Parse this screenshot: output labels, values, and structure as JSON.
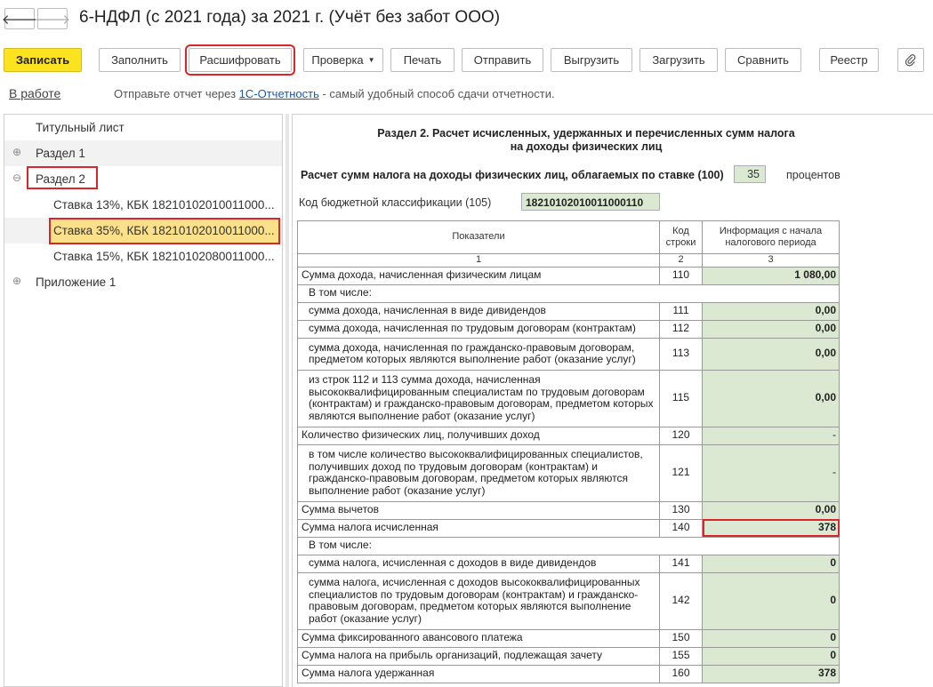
{
  "window": {
    "title": "6-НДФЛ (с 2021 года) за 2021 г. (Учёт без забот ООО)"
  },
  "nav": {
    "back": "🡐",
    "forward": "🡒"
  },
  "toolbar": {
    "save": "Записать",
    "fill": "Заполнить",
    "decode": "Расшифровать",
    "check": "Проверка",
    "print": "Печать",
    "send": "Отправить",
    "export": "Выгрузить",
    "import": "Загрузить",
    "compare": "Сравнить",
    "registry": "Реестр"
  },
  "status": {
    "state": "В работе",
    "hint_prefix": "Отправьте отчет через ",
    "hint_link": "1С-Отчетность",
    "hint_suffix": " - самый удобный способ сдачи отчетности."
  },
  "tree": {
    "items": [
      {
        "label": "Титульный лист"
      },
      {
        "label": "Раздел 1",
        "expander": "⊕"
      },
      {
        "label": "Раздел 2",
        "expander": "⊖"
      },
      {
        "label": "Ставка 13%, КБК 18210102010011000..."
      },
      {
        "label": "Ставка 35%, КБК 18210102010011000..."
      },
      {
        "label": "Ставка 15%, КБК 18210102080011000..."
      },
      {
        "label": "Приложение 1",
        "expander": "⊕"
      }
    ]
  },
  "form": {
    "section_title_1": "Раздел 2. Расчет исчисленных, удержанных и перечисленных сумм налога",
    "section_title_2": "на доходы физических лиц",
    "rate_label": "Расчет сумм налога на доходы физических лиц, облагаемых по ставке   (100)",
    "rate_value": "35",
    "rate_unit": "процентов",
    "kbk_label": "Код бюджетной классификации   (105)",
    "kbk_value": "18210102010011000110",
    "headers": {
      "indicator": "Показатели",
      "code": "Код строки",
      "info": "Информация с начала налогового периода",
      "n1": "1",
      "n2": "2",
      "n3": "3"
    },
    "rows": [
      {
        "label": "Сумма дохода, начисленная физическим лицам",
        "code": "110",
        "value": "1 080,00"
      },
      {
        "label": "В том числе:"
      },
      {
        "label": "сумма дохода, начисленная в виде дивидендов",
        "code": "111",
        "value": "0,00"
      },
      {
        "label": "сумма дохода, начисленная по трудовым договорам (контрактам)",
        "code": "112",
        "value": "0,00"
      },
      {
        "label": "сумма дохода, начисленная по гражданско-правовым договорам, предметом которых являются выполнение работ (оказание услуг)",
        "code": "113",
        "value": "0,00"
      },
      {
        "label": "из строк 112 и 113 сумма дохода, начисленная высококвалифицированным специалистам по трудовым договорам (контрактам) и гражданско-правовым договорам, предметом которых являются выполнение работ (оказание услуг)",
        "code": "115",
        "value": "0,00"
      },
      {
        "label": "Количество физических лиц, получивших доход",
        "code": "120",
        "value": "-"
      },
      {
        "label": "в том числе количество высококвалифицированных специалистов, получивших доход по трудовым договорам (контрактам) и гражданско-правовым договорам, предметом которых являются выполнение работ (оказание услуг)",
        "code": "121",
        "value": "-"
      },
      {
        "label": "Сумма вычетов",
        "code": "130",
        "value": "0,00"
      },
      {
        "label": "Сумма налога исчисленная",
        "code": "140",
        "value": "378"
      },
      {
        "label": "В том числе:"
      },
      {
        "label": "сумма налога, исчисленная с доходов в виде дивидендов",
        "code": "141",
        "value": "0"
      },
      {
        "label": "сумма налога, исчисленная с доходов высококвалифицированных специалистов по трудовым договорам (контрактам) и гражданско-правовым договорам, предметом которых являются выполнение работ (оказание услуг)",
        "code": "142",
        "value": "0"
      },
      {
        "label": "Сумма фиксированного авансового платежа",
        "code": "150",
        "value": "0"
      },
      {
        "label": "Сумма налога на прибыль организаций, подлежащая зачету",
        "code": "155",
        "value": "0"
      },
      {
        "label": "Сумма налога удержанная",
        "code": "160",
        "value": "378"
      }
    ]
  }
}
